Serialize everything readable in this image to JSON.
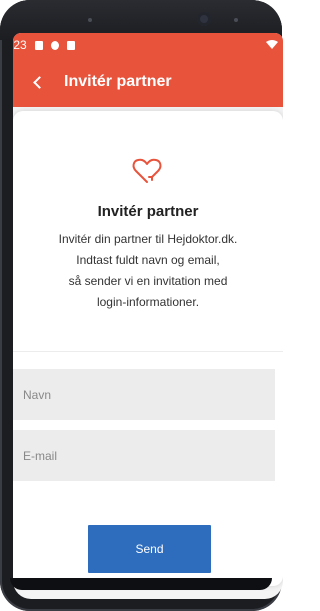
{
  "status_bar": {
    "time": ":23"
  },
  "app_bar": {
    "title": "Invitér partner",
    "back_icon": "chevron-left-icon"
  },
  "content": {
    "icon": "heart-icon",
    "title": "Invitér partner",
    "description_lines": [
      "Invitér din partner til Hejdoktor.dk.",
      "Indtast fuldt navn og email,",
      "så sender vi en invitation med",
      "login-informationer."
    ]
  },
  "form": {
    "name_placeholder": "Navn",
    "email_placeholder": "E-mail",
    "send_label": "Send"
  },
  "colors": {
    "accent": "#e8533c",
    "button": "#2e6dbe",
    "field_bg": "#ececec"
  }
}
